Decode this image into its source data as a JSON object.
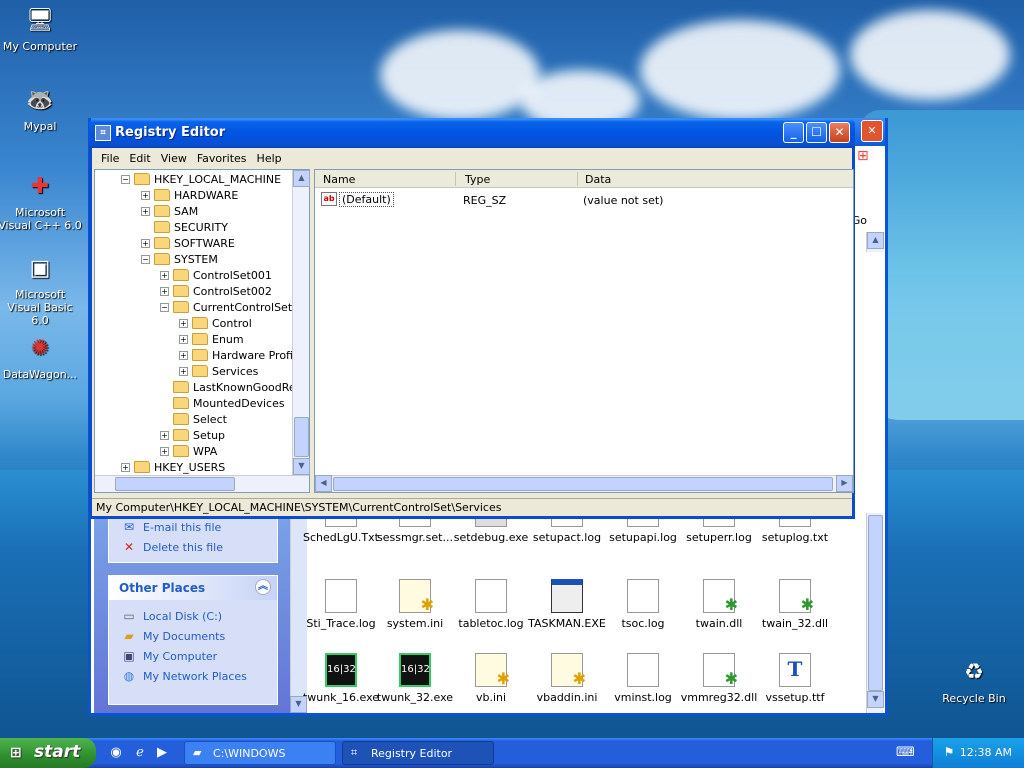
{
  "desktop": {
    "icons": [
      {
        "label": "My Computer",
        "icon": "my-computer-icon"
      },
      {
        "label": "Mypal",
        "icon": "raccoon-icon"
      },
      {
        "label": "Microsoft Visual C++ 6.0",
        "icon": "visual-cpp-icon"
      },
      {
        "label": "Microsoft Visual Basic 6.0",
        "icon": "visual-basic-icon"
      },
      {
        "label": "DataWagon...",
        "icon": "datawagon-icon"
      },
      {
        "label": "Recycle Bin",
        "icon": "recycle-bin-icon"
      }
    ]
  },
  "explorer": {
    "go_label": "Go",
    "file_tasks": {
      "email": "E-mail this file",
      "delete": "Delete this file"
    },
    "other_places": {
      "title": "Other Places",
      "links": [
        "Local Disk (C:)",
        "My Documents",
        "My Computer",
        "My Network Places"
      ]
    },
    "files_row1": [
      "SchedLgU.Txt",
      "sessmgr.set...",
      "setdebug.exe",
      "setupact.log",
      "setupapi.log",
      "setuperr.log",
      "setuplog.txt"
    ],
    "files_row2": [
      "Sti_Trace.log",
      "system.ini",
      "tabletoc.log",
      "TASKMAN.EXE",
      "tsoc.log",
      "twain.dll",
      "twain_32.dll"
    ],
    "files_row3": [
      "twunk_16.exe",
      "twunk_32.exe",
      "vb.ini",
      "vbaddin.ini",
      "vminst.log",
      "vmmreg32.dll",
      "vssetup.ttf"
    ]
  },
  "regedit": {
    "title": "Registry Editor",
    "menu": [
      "File",
      "Edit",
      "View",
      "Favorites",
      "Help"
    ],
    "tree": [
      "HKEY_LOCAL_MACHINE",
      "HARDWARE",
      "SAM",
      "SECURITY",
      "SOFTWARE",
      "SYSTEM",
      "ControlSet001",
      "ControlSet002",
      "CurrentControlSet",
      "Control",
      "Enum",
      "Hardware Profile",
      "Services",
      "LastKnownGoodRec",
      "MountedDevices",
      "Select",
      "Setup",
      "WPA",
      "HKEY_USERS"
    ],
    "columns": {
      "name": "Name",
      "type": "Type",
      "data": "Data"
    },
    "rows": [
      {
        "name": "(Default)",
        "type": "REG_SZ",
        "data": "(value not set)"
      }
    ],
    "status": "My Computer\\HKEY_LOCAL_MACHINE\\SYSTEM\\CurrentControlSet\\Services"
  },
  "taskbar": {
    "start_label": "start",
    "tasks": [
      "C:\\WINDOWS",
      "Registry Editor"
    ],
    "clock": "12:38 AM"
  }
}
